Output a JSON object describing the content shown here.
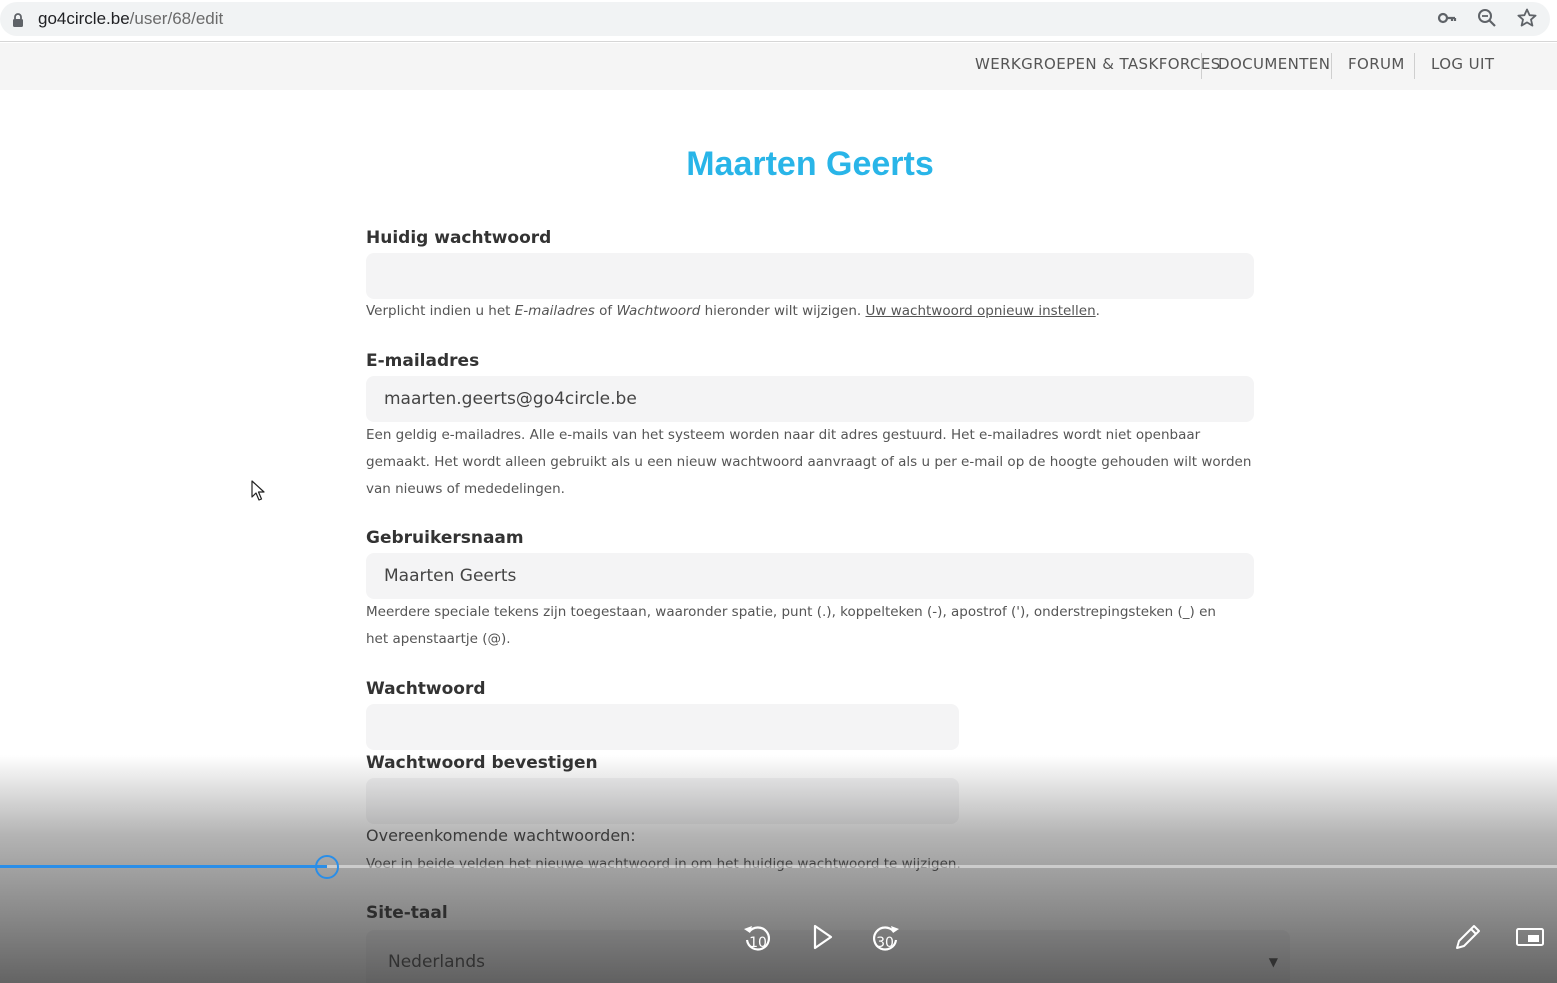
{
  "browser": {
    "url_domain": "go4circle.be",
    "url_path": "/user/68/edit",
    "icons": [
      "lock-icon",
      "key-icon",
      "zoom-icon",
      "star-icon"
    ]
  },
  "nav": {
    "items": [
      {
        "label": "WERKGROEPEN & TASKFORCES"
      },
      {
        "label": "DOCUMENTEN"
      },
      {
        "label": "FORUM"
      },
      {
        "label": "LOG UIT"
      }
    ]
  },
  "page": {
    "title": "Maarten Geerts"
  },
  "form": {
    "current_password": {
      "label": "Huidig wachtwoord",
      "value": "",
      "help_prefix": "Verplicht indien u het ",
      "help_em1": "E-mailadres",
      "help_of": " of ",
      "help_em2": "Wachtwoord",
      "help_mid": " hieronder wilt wijzigen. ",
      "help_link": "Uw wachtwoord opnieuw instellen",
      "help_end": "."
    },
    "email": {
      "label": "E-mailadres",
      "value": "maarten.geerts@go4circle.be",
      "help": "Een geldig e-mailadres. Alle e-mails van het systeem worden naar dit adres gestuurd. Het e-mailadres wordt niet openbaar gemaakt. Het wordt alleen gebruikt als u een nieuw wachtwoord aanvraagt of als u per e-mail op de hoogte gehouden wilt worden van nieuws of mededelingen."
    },
    "username": {
      "label": "Gebruikersnaam",
      "value": "Maarten Geerts",
      "help": "Meerdere speciale tekens zijn toegestaan, waaronder spatie, punt (.), koppelteken (-), apostrof ('), onderstrepingsteken (_) en het apenstaartje (@)."
    },
    "password": {
      "label": "Wachtwoord",
      "value": ""
    },
    "password_confirm": {
      "label": "Wachtwoord bevestigen",
      "value": ""
    },
    "match_label": "Overeenkomende wachtwoorden:",
    "password_help": "Voer in beide velden het nieuwe wachtwoord in om het huidige wachtwoord te wijzigen.",
    "site_language": {
      "label": "Site-taal",
      "selected": "Nederlands"
    }
  },
  "player": {
    "progress_fraction": 0.21,
    "rewind_seconds": "10",
    "forward_seconds": "30",
    "accent_color": "#2a8ee8"
  },
  "colors": {
    "title": "#29b5e8",
    "input_bg": "#f4f4f5"
  }
}
